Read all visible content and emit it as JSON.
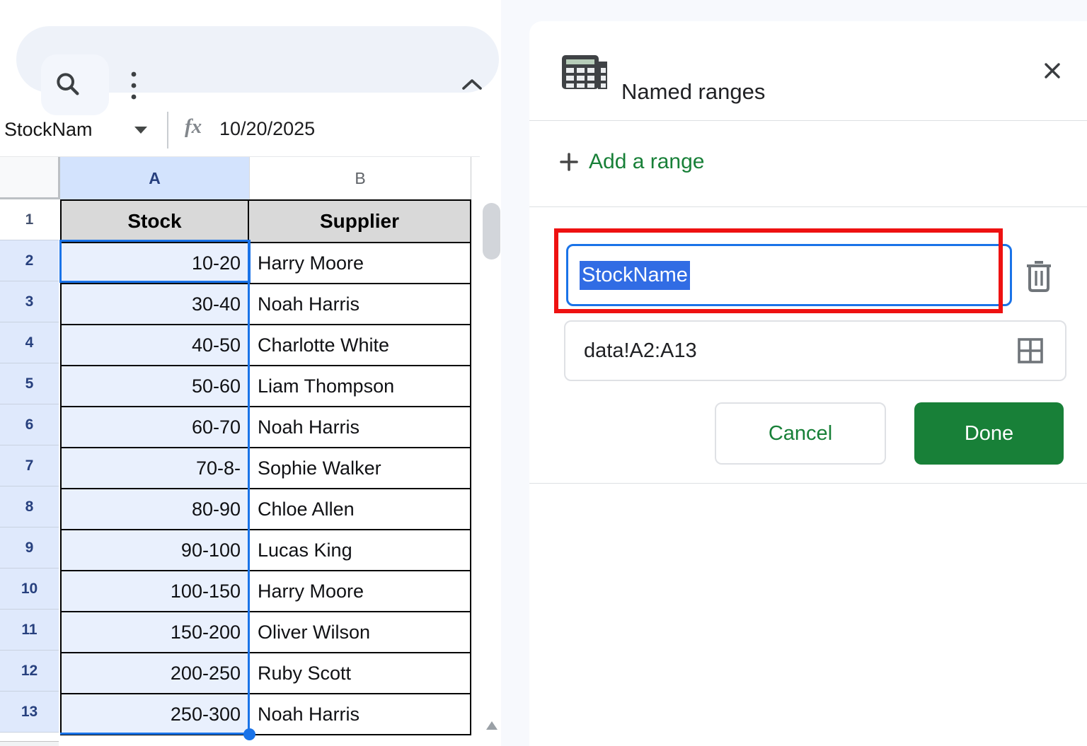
{
  "toolbar": {
    "search_icon": "search-icon",
    "more_icon": "vertical-dots-menu-icon",
    "collapse_icon": "chevron-up-icon"
  },
  "name_box": {
    "value": "StockNam"
  },
  "formula_bar": {
    "fx_label": "fx",
    "value": "10/20/2025"
  },
  "grid": {
    "column_headers": [
      "A",
      "B"
    ],
    "header_row": {
      "number": "1",
      "cells": [
        "Stock",
        "Supplier"
      ]
    },
    "rows": [
      {
        "number": "2",
        "stock": "10-20",
        "supplier": "Harry Moore"
      },
      {
        "number": "3",
        "stock": "30-40",
        "supplier": "Noah Harris"
      },
      {
        "number": "4",
        "stock": "40-50",
        "supplier": "Charlotte White"
      },
      {
        "number": "5",
        "stock": "50-60",
        "supplier": "Liam Thompson"
      },
      {
        "number": "6",
        "stock": "60-70",
        "supplier": "Noah Harris"
      },
      {
        "number": "7",
        "stock": "70-8-",
        "supplier": "Sophie Walker"
      },
      {
        "number": "8",
        "stock": "80-90",
        "supplier": "Chloe Allen"
      },
      {
        "number": "9",
        "stock": "90-100",
        "supplier": "Lucas King"
      },
      {
        "number": "10",
        "stock": "100-150",
        "supplier": "Harry Moore"
      },
      {
        "number": "11",
        "stock": "150-200",
        "supplier": "Oliver Wilson"
      },
      {
        "number": "12",
        "stock": "200-250",
        "supplier": "Ruby Scott"
      },
      {
        "number": "13",
        "stock": "250-300",
        "supplier": "Noah Harris"
      }
    ],
    "selected_cell": "A2",
    "selected_range_rows": "2-13"
  },
  "panel": {
    "title": "Named ranges",
    "add_range_label": "Add a range",
    "range_name_value": "StockName",
    "range_ref_value": "data!A2:A13",
    "cancel_label": "Cancel",
    "done_label": "Done"
  },
  "colors": {
    "accent_blue": "#1a73e8",
    "selection_blue": "#316ce4",
    "annotation_red": "#ee1111",
    "green": "#188038",
    "column_header_blue": "#d3e3fd",
    "range_fill_blue": "#e9f0fd",
    "row_header_blue": "#dfe9fc",
    "table_header_gray": "#d9d9d9"
  }
}
